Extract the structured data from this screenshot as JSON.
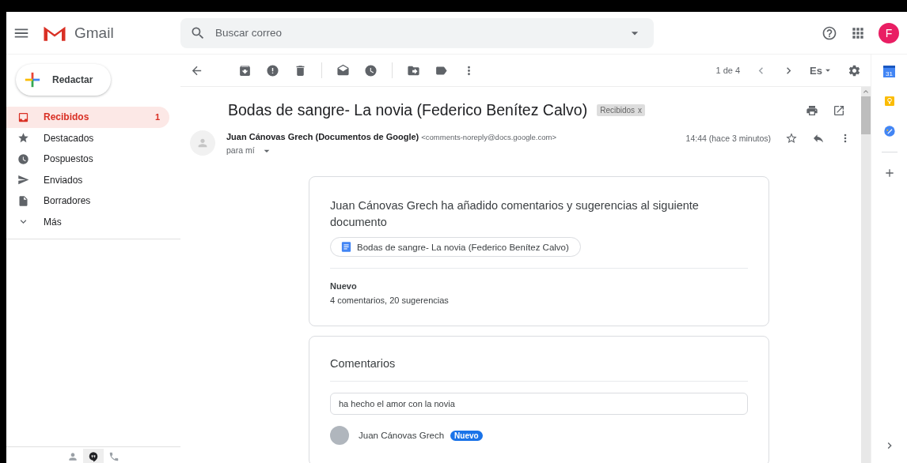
{
  "header": {
    "app_name": "Gmail",
    "search": {
      "placeholder": "Buscar correo"
    },
    "account_initial": "F"
  },
  "compose": {
    "label": "Redactar"
  },
  "sidebar": {
    "items": [
      {
        "label": "Recibidos",
        "kind": "inbox",
        "count": "1",
        "selected": true
      },
      {
        "label": "Destacados",
        "kind": "starred",
        "selected": false
      },
      {
        "label": "Pospuestos",
        "kind": "snoozed",
        "selected": false
      },
      {
        "label": "Enviados",
        "kind": "sent",
        "selected": false
      },
      {
        "label": "Borradores",
        "kind": "drafts",
        "selected": false
      },
      {
        "label": "Más",
        "kind": "more",
        "selected": false
      }
    ]
  },
  "hangouts_tabs": [
    {
      "kind": "contacts",
      "selected": false
    },
    {
      "kind": "chat",
      "selected": true
    },
    {
      "kind": "calls",
      "selected": false
    }
  ],
  "toolbar": {
    "pagination": "1 de 4",
    "input_tool": "Es"
  },
  "message": {
    "subject": "Bodas de sangre- La novia (Federico Benítez Calvo)",
    "label_chip": "Recibidos",
    "label_remove": "x",
    "sender_name": "Juan Cánovas Grech (Documentos de Google)",
    "sender_email": "<comments-noreply@docs.google.com>",
    "recipient": "para mí",
    "time": "14:44 (hace 3 minutos)",
    "starred": false
  },
  "body": {
    "summary": "Juan Cánovas Grech ha añadido comentarios y sugerencias al siguiente documento",
    "document_link": "Bodas de sangre- La novia (Federico Benítez Calvo)",
    "new_heading": "Nuevo",
    "new_counts": "4 comentarios, 20 sugerencias",
    "comments_heading": "Comentarios",
    "quoted_text": "ha hecho el amor con la novia",
    "commenter": "Juan Cánovas Grech",
    "commenter_badge": "Nuevo"
  },
  "right_panel": {
    "calendar_day": "31"
  }
}
